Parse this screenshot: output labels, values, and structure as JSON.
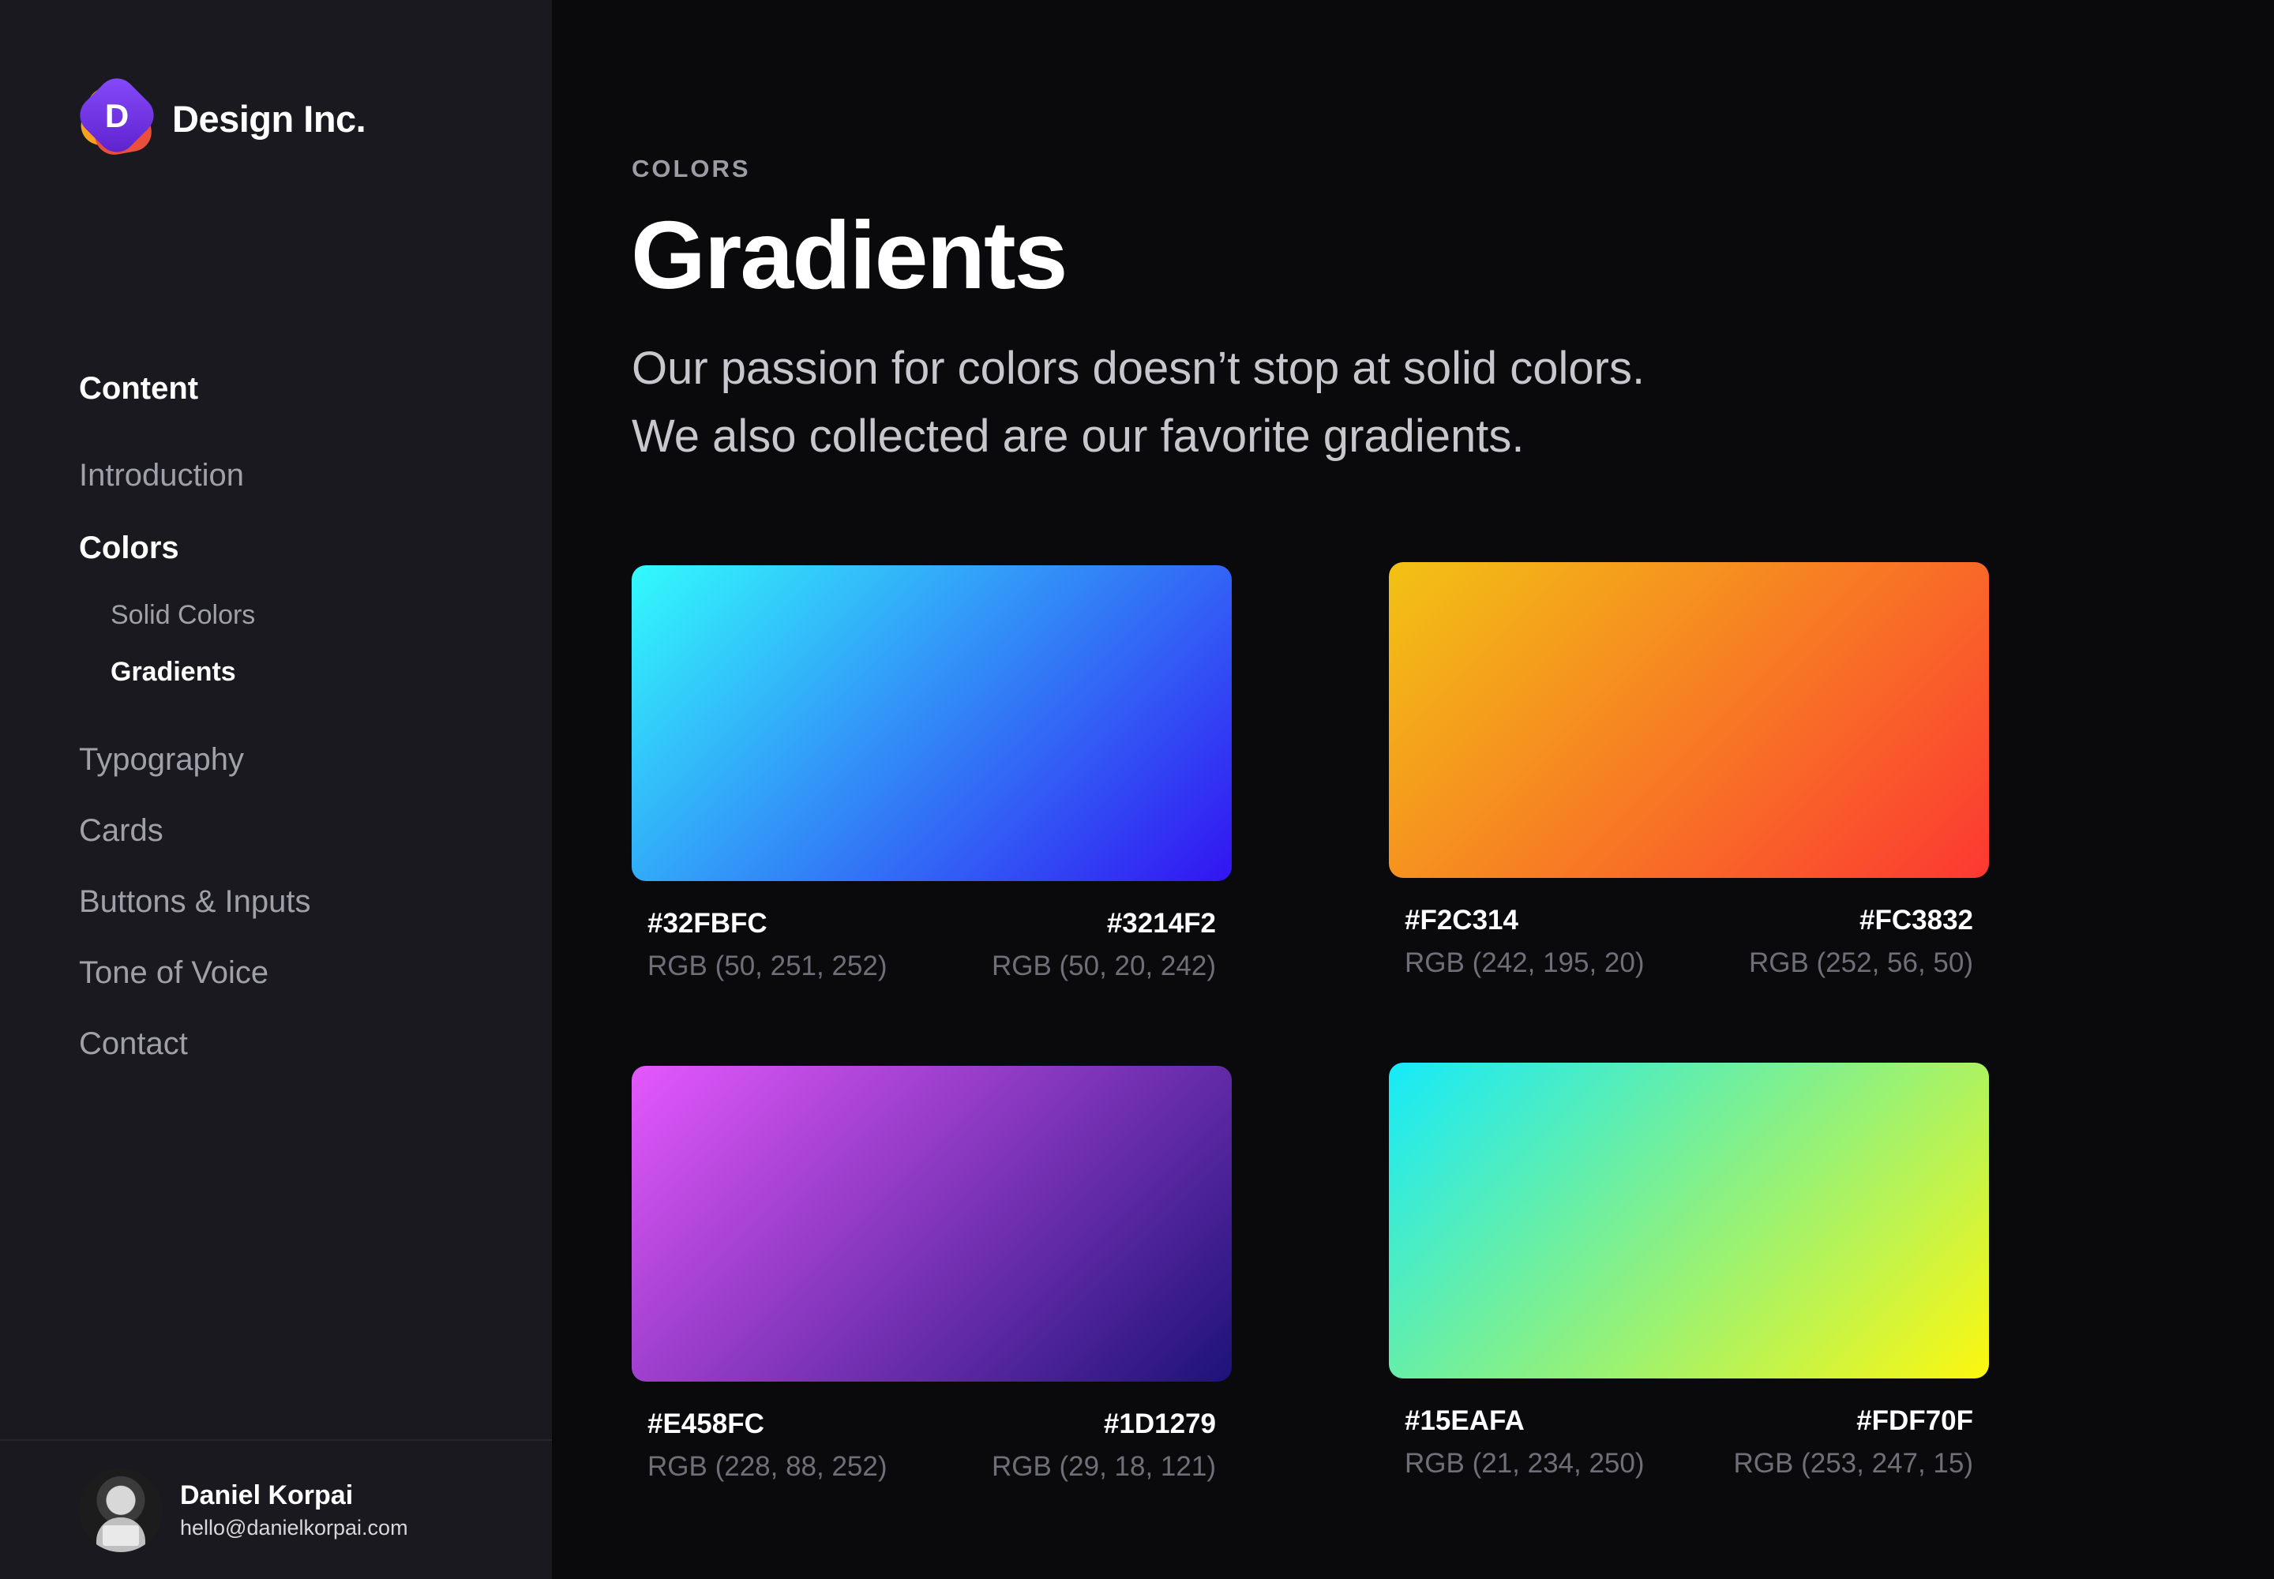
{
  "brand": {
    "logo_letter": "D",
    "name": "Design Inc.",
    "logo_colors": [
      "#f7a21b",
      "#ea4f3c",
      "#7b3ff2"
    ]
  },
  "sidebar": {
    "heading": "Content",
    "items": [
      {
        "label": "Introduction",
        "active": false
      },
      {
        "label": "Colors",
        "active": true,
        "children": [
          {
            "label": "Solid Colors",
            "active": false
          },
          {
            "label": "Gradients",
            "active": true
          }
        ]
      },
      {
        "label": "Typography",
        "active": false
      },
      {
        "label": "Cards",
        "active": false
      },
      {
        "label": "Buttons & Inputs",
        "active": false
      },
      {
        "label": "Tone of Voice",
        "active": false
      },
      {
        "label": "Contact",
        "active": false
      }
    ]
  },
  "profile": {
    "name": "Daniel Korpai",
    "email": "hello@danielkorpai.com"
  },
  "page": {
    "eyebrow": "COLORS",
    "title": "Gradients",
    "description_line1": "Our passion for colors doesn’t stop at solid colors.",
    "description_line2": "We also collected are our favorite gradients."
  },
  "gradients": [
    {
      "start_hex": "#32FBFC",
      "start_rgb": "RGB (50, 251, 252)",
      "end_hex": "#3214F2",
      "end_rgb": "RGB (50, 20, 242)"
    },
    {
      "start_hex": "#F2C314",
      "start_rgb": "RGB (242, 195, 20)",
      "end_hex": "#FC3832",
      "end_rgb": "RGB (252, 56, 50)"
    },
    {
      "start_hex": "#E458FC",
      "start_rgb": "RGB (228, 88, 252)",
      "end_hex": "#1D1279",
      "end_rgb": "RGB (29, 18, 121)"
    },
    {
      "start_hex": "#15EAFA",
      "start_rgb": "RGB (21, 234, 250)",
      "end_hex": "#FDF70F",
      "end_rgb": "RGB (253, 247, 15)"
    }
  ]
}
